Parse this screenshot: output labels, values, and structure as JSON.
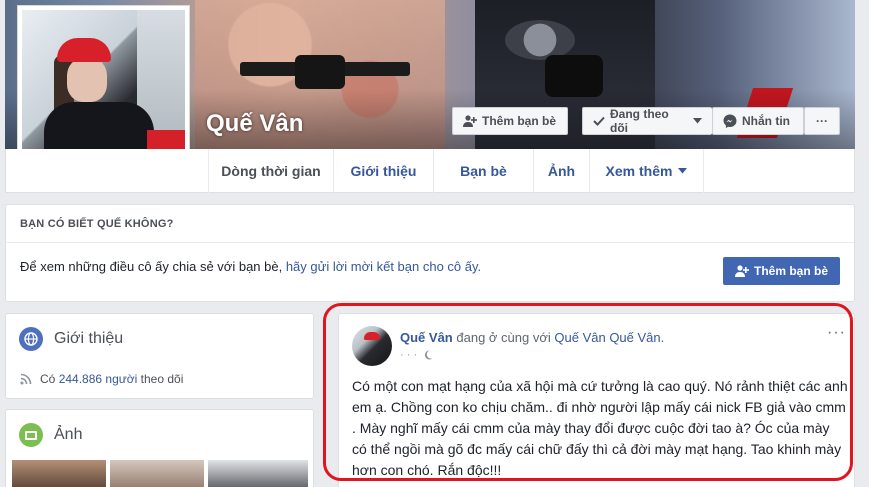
{
  "profile": {
    "name": "Quế Vân",
    "actions": {
      "add_friend": "Thêm bạn bè",
      "following": "Đang theo dõi",
      "message": "Nhắn tin",
      "more": "···"
    }
  },
  "tabs": [
    {
      "label": "Dòng thời gian"
    },
    {
      "label": "Giới thiệu"
    },
    {
      "label": "Bạn bè"
    },
    {
      "label": "Ảnh"
    },
    {
      "label": "Xem thêm"
    }
  ],
  "know_card": {
    "heading": "BẠN CÓ BIẾT QUẾ KHÔNG?",
    "text_prefix": "Để xem những điều cô ấy chia sẻ với bạn bè, ",
    "text_link": "hãy gửi lời mời kết bạn cho cô ấy.",
    "button": "Thêm bạn bè"
  },
  "intro": {
    "title": "Giới thiệu",
    "followers_prefix": "Có",
    "followers_count": "244.886 người",
    "followers_suffix": "theo dõi"
  },
  "photos": {
    "title": "Ảnh"
  },
  "post": {
    "author": "Quế Vân",
    "action": "đang ở cùng với",
    "tagged": "Quế Vân Quế Vân.",
    "meta": "· · ·",
    "dots": "···",
    "body": "Có một con mạt hạng của xã hội mà cứ tưởng là cao quý. Nó rảnh thiệt các anh em ạ. Chồng con ko chịu chăm.. đi nhờ người lập mấy cái nick FB giả vào cmm . Mày nghĩ mấy cái cmm của mày thay đổi được cuộc đời tao à? Óc của mày có thể ngồi mà gõ đc mấy cái chữ đấy thì cả đời mày mạt hạng. Tao khinh mày hơn con chó. Rắn độc!!!"
  },
  "colors": {
    "link": "#365899",
    "primary": "#4267b2",
    "highlight": "#e0151d"
  }
}
